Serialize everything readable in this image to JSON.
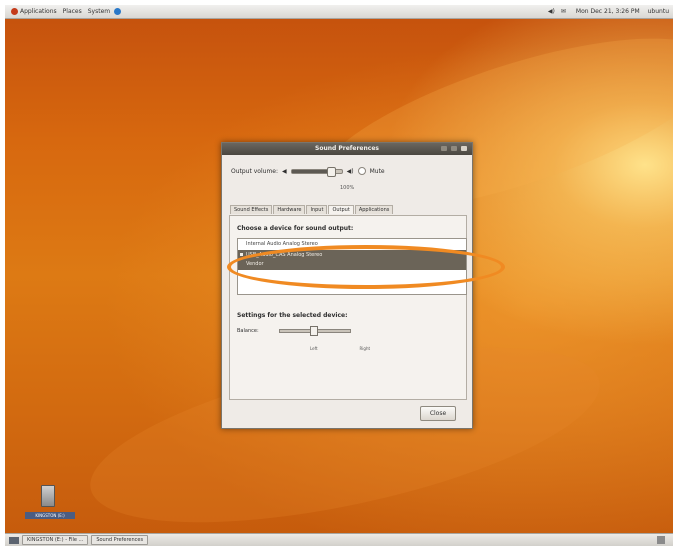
{
  "top_panel": {
    "menus": [
      "Applications",
      "Places",
      "System"
    ],
    "clock": "Mon Dec 21, 3:26 PM",
    "user": "ubuntu"
  },
  "desktop": {
    "usb_label": "KINGSTON (E:)"
  },
  "window": {
    "title": "Sound Preferences",
    "output_volume_label": "Output volume:",
    "mute_label": "Mute",
    "volume_percent": "100%",
    "volume_level": 0.78,
    "tabs": [
      "Sound Effects",
      "Hardware",
      "Input",
      "Output",
      "Applications"
    ],
    "active_tab": "Output",
    "choose_device_title": "Choose a device for sound output:",
    "devices": [
      {
        "name": "Internal Audio Analog Stereo",
        "sub": ""
      },
      {
        "name": "USB_Audio_CAS Analog Stereo",
        "sub": "Vendor"
      }
    ],
    "selected_device_index": 1,
    "settings_title": "Settings for the selected device:",
    "balance_label": "Balance:",
    "balance_left": "Left",
    "balance_right": "Right",
    "close_label": "Close"
  },
  "bottom_panel": {
    "tasks": [
      "KINGSTON (E:) - File ...",
      "Sound Preferences"
    ]
  },
  "colors": {
    "annotation": "#f08a22",
    "selection": "#6b6458"
  }
}
